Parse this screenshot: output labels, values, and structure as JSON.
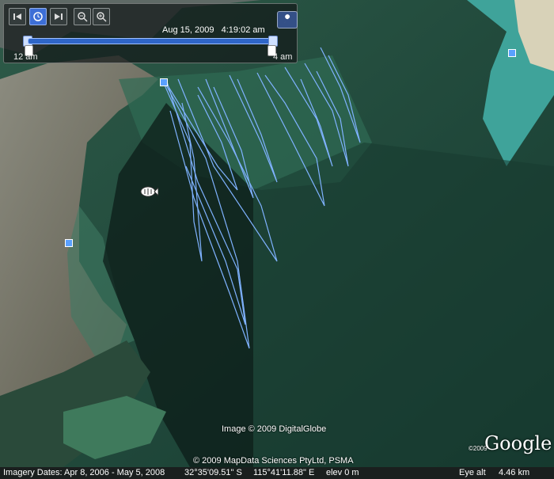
{
  "toolbar": {
    "time_label": "Aug 15, 2009   4:19:02 am",
    "start_label": "12 am",
    "end_label": "4 am",
    "buttons": [
      "skip-back-icon",
      "clock-icon",
      "skip-forward-icon",
      "zoom-out-icon",
      "zoom-in-icon"
    ],
    "wrench_icon": "wrench-icon"
  },
  "map": {
    "image_credit": "Image © 2009 DigitalGlobe",
    "data_credit": "© 2009 MapData Sciences PtyLtd, PSMA",
    "copyright_small": "©2009",
    "logo_text": "Google",
    "boat_icon": "fish-boat-icon",
    "placemark_icon": "square-placemark-icon",
    "track_color": "#7fb2ff"
  },
  "status": {
    "imagery_dates": "Imagery Dates: Apr  8, 2006 - May  5, 2008",
    "lat": "32°35'09.51\" S",
    "lon": "115°41'11.88\" E",
    "elev": "elev   0 m",
    "eye_alt_label": "Eye alt",
    "eye_alt_value": "4.46 km"
  }
}
